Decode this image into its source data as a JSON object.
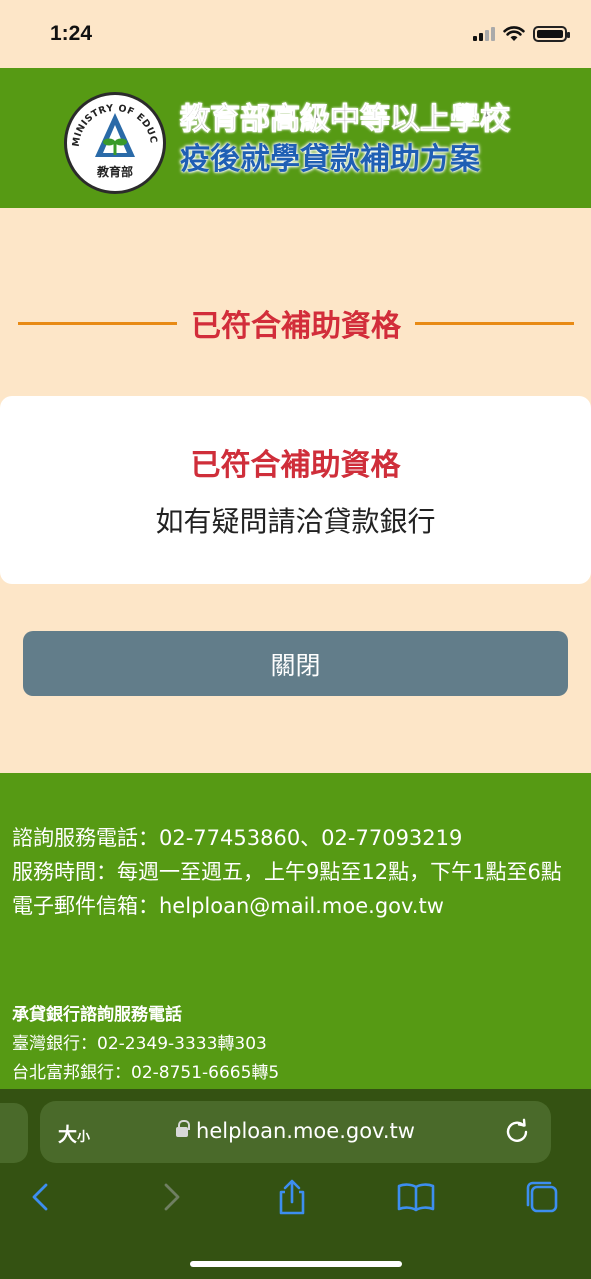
{
  "status_bar": {
    "time": "1:24"
  },
  "header": {
    "logo_ring_text": "MINISTRY OF EDUCATION",
    "logo_bottom_text": "教育部",
    "title_line1": "教育部高級中等以上學校",
    "title_line2": "疫後就學貸款補助方案"
  },
  "result": {
    "section_heading": "已符合補助資格",
    "card_title": "已符合補助資格",
    "card_message": "如有疑問請洽貸款銀行",
    "close_label": "關閉"
  },
  "footer": {
    "phone": "諮詢服務電話：02-77453860、02-77093219",
    "hours": "服務時間：每週一至週五，上午9點至12點，下午1點至6點",
    "email": "電子郵件信箱：helploan@mail.moe.gov.tw",
    "bank_title": "承貸銀行諮詢服務電話",
    "bank_1": "臺灣銀行：02-2349-3333轉303",
    "bank_2": "台北富邦銀行：02-8751-6665轉5"
  },
  "browser": {
    "text_size_label": "大",
    "text_size_small": "小",
    "url": "helploan.moe.gov.tw"
  },
  "colors": {
    "page_bg": "#fde6c8",
    "brand_green": "#569a14",
    "heading_red": "#d22d3a",
    "accent_orange": "#e88a14",
    "button_slate": "#627d8a",
    "link_blue": "#3d8ef0"
  },
  "icons": [
    "signal-icon",
    "wifi-icon",
    "battery-icon",
    "lock-icon",
    "reload-icon",
    "back-icon",
    "forward-icon",
    "share-icon",
    "bookmarks-icon",
    "tabs-icon"
  ]
}
